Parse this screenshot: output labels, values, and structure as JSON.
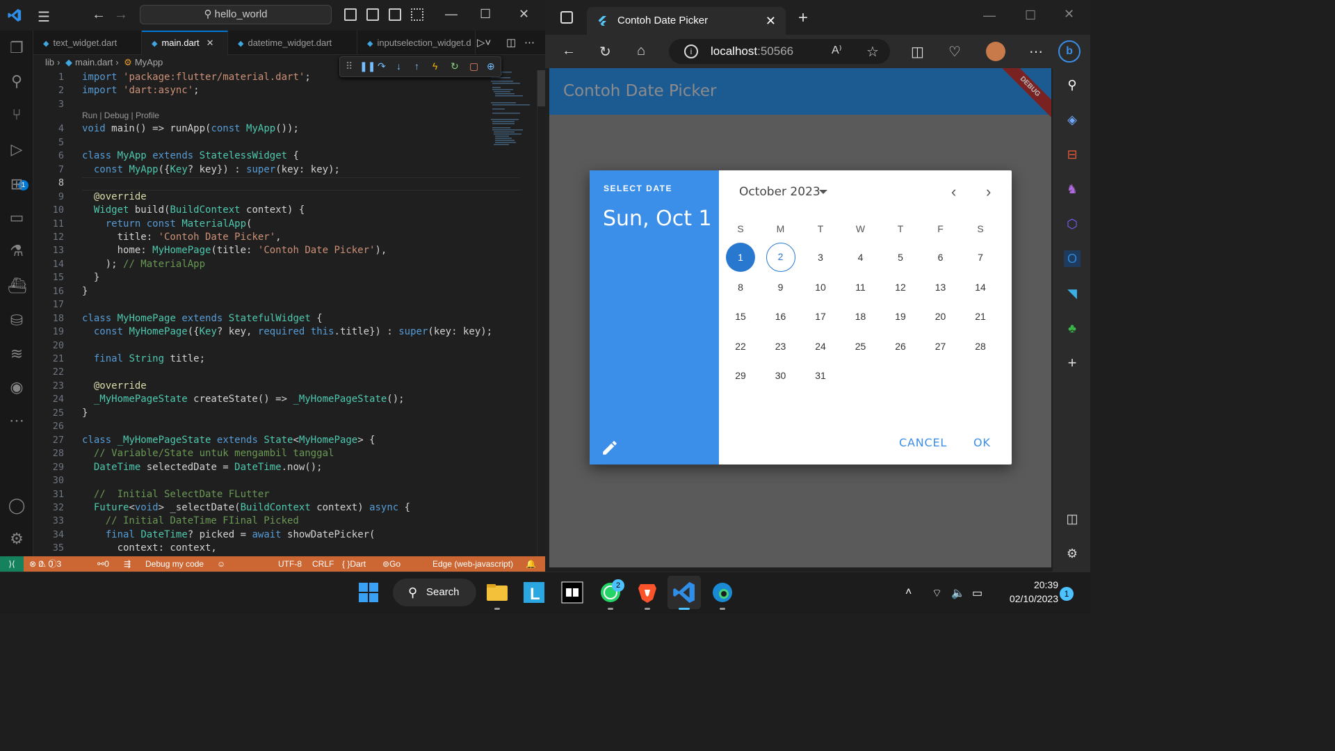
{
  "vscode": {
    "search": "hello_world",
    "tabs": [
      {
        "label": "text_widget.dart",
        "active": false
      },
      {
        "label": "main.dart",
        "active": true
      },
      {
        "label": "datetime_widget.dart",
        "active": false
      },
      {
        "label": "inputselection_widget.d",
        "active": false
      }
    ],
    "breadcrumb": {
      "folder": "lib",
      "file": "main.dart",
      "symbol": "MyApp"
    },
    "codelens": "Run | Debug | Profile",
    "line_numbers": [
      "1",
      "2",
      "3",
      "4",
      "5",
      "6",
      "7",
      "8",
      "9",
      "10",
      "11",
      "12",
      "13",
      "14",
      "15",
      "16",
      "17",
      "18",
      "19",
      "20",
      "21",
      "22",
      "23",
      "24",
      "25",
      "26",
      "27",
      "28",
      "29",
      "30",
      "31",
      "32",
      "33",
      "34",
      "35"
    ],
    "code": [
      "import 'package:flutter/material.dart';",
      "import 'dart:async';",
      "",
      "void main() => runApp(const MyApp());",
      "",
      "class MyApp extends StatelessWidget {",
      "  const MyApp({Key? key}) : super(key: key);",
      "",
      "  @override",
      "  Widget build(BuildContext context) {",
      "    return const MaterialApp(",
      "      title: 'Contoh Date Picker',",
      "      home: MyHomePage(title: 'Contoh Date Picker'),",
      "    ); // MaterialApp",
      "  }",
      "}",
      "",
      "class MyHomePage extends StatefulWidget {",
      "  const MyHomePage({Key? key, required this.title}) : super(key: key);",
      "",
      "  final String title;",
      "",
      "  @override",
      "  _MyHomePageState createState() => _MyHomePageState();",
      "}",
      "",
      "class _MyHomePageState extends State<MyHomePage> {",
      "  // Variable/State untuk mengambil tanggal",
      "  DateTime selectedDate = DateTime.now();",
      "",
      "  //  Initial SelectDate FLutter",
      "  Future<void> _selectDate(BuildContext context) async {",
      "    // Initial DateTime FIinal Picked",
      "    final DateTime? picked = await showDatePicker(",
      "      context: context,"
    ],
    "status": {
      "errors": "0",
      "warnings": "0",
      "info": "3",
      "ports": "0",
      "debug": "Debug my code",
      "encoding": "UTF-8",
      "eol": "CRLF",
      "language": "Dart",
      "golive": "Go Live",
      "device": "Edge (web-javascript)"
    },
    "accent": "#0078d4",
    "status_color": "#cc6633"
  },
  "edge": {
    "tab_title": "Contoh Date Picker",
    "url_host": "localhost",
    "url_port": ":50566",
    "app_title": "Contoh Date Picker",
    "debug_banner": "DEBUG"
  },
  "date_picker": {
    "header_label": "SELECT DATE",
    "selected_text": "Sun, Oct 1",
    "month_label": "October 2023",
    "weekdays": [
      "S",
      "M",
      "T",
      "W",
      "T",
      "F",
      "S"
    ],
    "first_weekday_offset": 0,
    "days_in_month": 31,
    "selected_day": 1,
    "today_day": 2,
    "cancel": "CANCEL",
    "ok": "OK",
    "primary_color": "#3b8fe8"
  },
  "taskbar": {
    "search": "Search",
    "whatsapp_badge": "2",
    "time": "20:39",
    "date": "02/10/2023",
    "notifications": "1"
  }
}
